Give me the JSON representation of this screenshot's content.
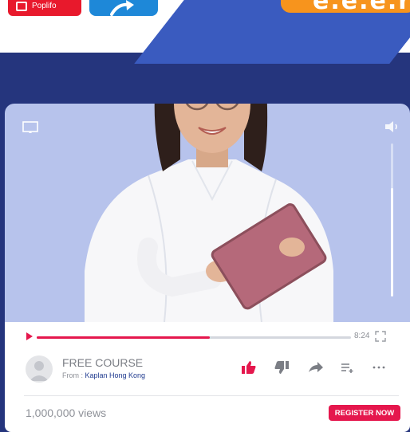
{
  "header": {
    "app_tile_red_label": "Poplifo",
    "promo_text": "e.e.e.r"
  },
  "player": {
    "progress": 0.55,
    "time": "8:24",
    "volume": 0.7
  },
  "course": {
    "title": "FREE COURSE",
    "from_label": "From : ",
    "from_name": "Kaplan Hong Kong"
  },
  "stats": {
    "views": "1,000,000 views"
  },
  "actions": {
    "register_label": "REGISTER NOW"
  },
  "colors": {
    "accent": "#e5174d",
    "navy": "#25357d",
    "video_bg": "#b7c3ec",
    "orange": "#f7941d",
    "blue_panel": "#3a5bbf"
  },
  "icons": [
    "cast-icon",
    "volume-icon",
    "play-icon",
    "fullscreen-icon",
    "avatar-icon",
    "like-icon",
    "dislike-icon",
    "share-icon",
    "playlist-add-icon",
    "more-icon"
  ]
}
